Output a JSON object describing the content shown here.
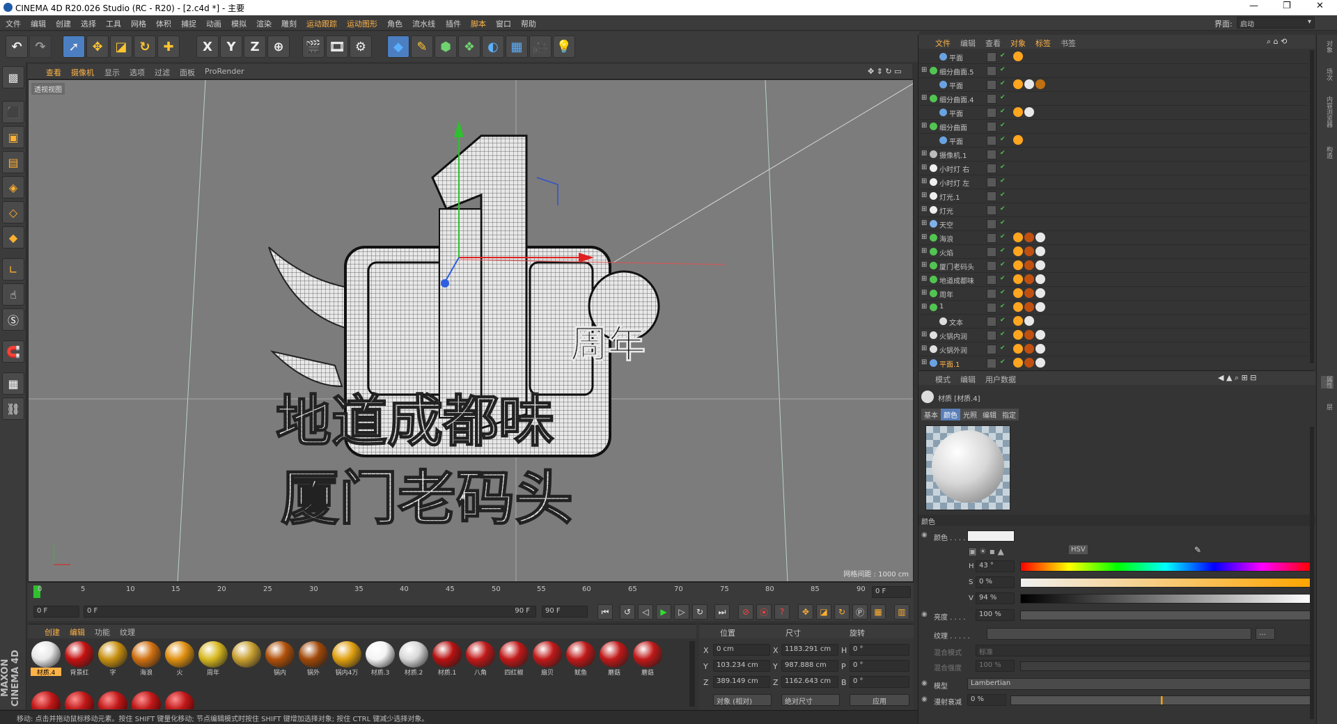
{
  "window": {
    "title": "CINEMA 4D R20.026 Studio (RC - R20) - [2.c4d *] - 主要",
    "min": "—",
    "max": "❐",
    "close": "✕"
  },
  "menubar": {
    "items": [
      "文件",
      "编辑",
      "创建",
      "选择",
      "工具",
      "网格",
      "体积",
      "捕捉",
      "动画",
      "模拟",
      "渲染",
      "雕刻",
      "运动跟踪",
      "运动图形",
      "角色",
      "流水线",
      "插件",
      "脚本",
      "窗口",
      "帮助"
    ],
    "layout_label": "界面:",
    "layout_value": "启动"
  },
  "toolbar": {
    "x": "X",
    "y": "Y",
    "z": "Z"
  },
  "viewport": {
    "menu": [
      "查看",
      "摄像机",
      "显示",
      "选项",
      "过滤",
      "面板",
      "ProRender"
    ],
    "label": "透视视图",
    "grid_spacing": "网格间距 : 1000 cm",
    "title_text": "周年",
    "line1": "地道成都味",
    "line2": "厦门老码头"
  },
  "timeline": {
    "ticks": [
      "0",
      "5",
      "10",
      "15",
      "20",
      "25",
      "30",
      "35",
      "40",
      "45",
      "50",
      "55",
      "60",
      "65",
      "70",
      "75",
      "80",
      "85",
      "90"
    ],
    "current_frame": "0 F"
  },
  "transport": {
    "start": "0 F",
    "range_start": "0 F",
    "range_end": "90 F",
    "end": "90 F"
  },
  "materials": {
    "menu": [
      "创建",
      "编辑",
      "功能",
      "纹理"
    ],
    "items": [
      {
        "name": "材质.4",
        "color": "#e8e8e8"
      },
      {
        "name": "背景红",
        "color": "#c41010"
      },
      {
        "name": "字",
        "color": "#c89010"
      },
      {
        "name": "海浪",
        "color": "#d07010"
      },
      {
        "name": "火",
        "color": "#e09010"
      },
      {
        "name": "周年",
        "color": "#d8b820"
      },
      {
        "name": "",
        "color": "#c9a030"
      },
      {
        "name": "锅内",
        "color": "#b05008"
      },
      {
        "name": "锅外",
        "color": "#a04808"
      },
      {
        "name": "锅内4万",
        "color": "#e0a010"
      },
      {
        "name": "材质.3",
        "color": "#f4f4f4"
      },
      {
        "name": "材质.2",
        "color": "#d8d8d8"
      },
      {
        "name": "材质.1",
        "color": "#b81010"
      },
      {
        "name": "八角",
        "color": "#c01818"
      },
      {
        "name": "四红椒",
        "color": "#c01818"
      },
      {
        "name": "扇贝",
        "color": "#c01818"
      },
      {
        "name": "鱿鱼",
        "color": "#c01818"
      },
      {
        "name": "蘑菇",
        "color": "#c01818"
      },
      {
        "name": "蘑菇",
        "color": "#c01818"
      }
    ]
  },
  "coords": {
    "head_pos": "位置",
    "head_size": "尺寸",
    "head_rot": "旋转",
    "px": "0 cm",
    "py": "103.234 cm",
    "pz": "389.149 cm",
    "sx": "1183.291 cm",
    "sy": "987.888 cm",
    "sz": "1162.643 cm",
    "rh": "0 °",
    "rp": "0 °",
    "rb": "0 °",
    "lx": "X",
    "ly": "Y",
    "lz": "Z",
    "lh": "H",
    "lp": "P",
    "lb": "B",
    "mode1": "对象 (相对)",
    "mode2": "绝对尺寸",
    "apply": "应用"
  },
  "objects": {
    "menu": [
      "文件",
      "编辑",
      "查看",
      "对象",
      "标签",
      "书签"
    ],
    "rows": [
      {
        "name": "平面",
        "indent": 2,
        "icon": "#6aa2e0"
      },
      {
        "name": "细分曲面.5",
        "indent": 1,
        "icon": "#52c452"
      },
      {
        "name": "平面",
        "indent": 2,
        "icon": "#6aa2e0"
      },
      {
        "name": "细分曲面.4",
        "indent": 1,
        "icon": "#52c452"
      },
      {
        "name": "平面",
        "indent": 2,
        "icon": "#6aa2e0"
      },
      {
        "name": "细分曲面",
        "indent": 1,
        "icon": "#52c452"
      },
      {
        "name": "平面",
        "indent": 2,
        "icon": "#6aa2e0"
      },
      {
        "name": "摄像机.1",
        "indent": 1,
        "icon": "#bbbbbb"
      },
      {
        "name": "小时灯 右",
        "indent": 1,
        "icon": "#eeeeee"
      },
      {
        "name": "小时灯 左",
        "indent": 1,
        "icon": "#eeeeee"
      },
      {
        "name": "灯光.1",
        "indent": 1,
        "icon": "#eeeeee"
      },
      {
        "name": "灯光",
        "indent": 1,
        "icon": "#eeeeee"
      },
      {
        "name": "天空",
        "indent": 1,
        "icon": "#7fb0e8"
      },
      {
        "name": "海浪",
        "indent": 1,
        "icon": "#52c452"
      },
      {
        "name": "火焰",
        "indent": 1,
        "icon": "#52c452"
      },
      {
        "name": "厦门老码头",
        "indent": 1,
        "icon": "#52c452"
      },
      {
        "name": "地道成都味",
        "indent": 1,
        "icon": "#52c452"
      },
      {
        "name": "周年",
        "indent": 1,
        "icon": "#52c452"
      },
      {
        "name": "1",
        "indent": 1,
        "icon": "#52c452"
      },
      {
        "name": "文本",
        "indent": 2,
        "icon": "#dddddd"
      },
      {
        "name": "火锅内润",
        "indent": 1,
        "icon": "#e0e0e0"
      },
      {
        "name": "火锅外润",
        "indent": 1,
        "icon": "#e0e0e0"
      },
      {
        "name": "平面.1",
        "indent": 1,
        "icon": "#6aa2e0"
      }
    ]
  },
  "attributes": {
    "menu": [
      "模式",
      "编辑",
      "用户数据"
    ],
    "material_name": "材质 [材质.4]",
    "tabs": [
      "基本",
      "颜色",
      "光照",
      "编辑",
      "指定"
    ],
    "section": "颜色",
    "color_label": "颜色 . . . .",
    "h_label": "H",
    "h_value": "43 °",
    "s_label": "S",
    "s_value": "0 %",
    "v_label": "V",
    "v_value": "94 %",
    "brightness_label": "亮度 . . . .",
    "brightness_value": "100 %",
    "texture_label": "纹理 . . . . .",
    "blend_mode_label": "混合模式",
    "blend_mode_value": "标准",
    "blend_strength_label": "混合强度",
    "blend_strength_value": "100 %",
    "model_label": "模型",
    "model_value": "Lambertian",
    "diffuse_label": "漫射衰减",
    "diffuse_value": "0 %",
    "hsv": "HSV"
  },
  "rightstrip": {
    "tabs": [
      "对象",
      "场次",
      "内容浏览器",
      "构造",
      "属性",
      "层"
    ]
  },
  "status": "移动: 点击并拖动鼠标移动元素。按住 SHIFT 键量化移动; 节点编辑模式时按住 SHIFT 键增加选择对象; 按住 CTRL 键减少选择对象。",
  "maxon": "MAXON CINEMA 4D",
  "colors": {
    "accent": "#ffb347",
    "selection": "#4c7fc2"
  }
}
